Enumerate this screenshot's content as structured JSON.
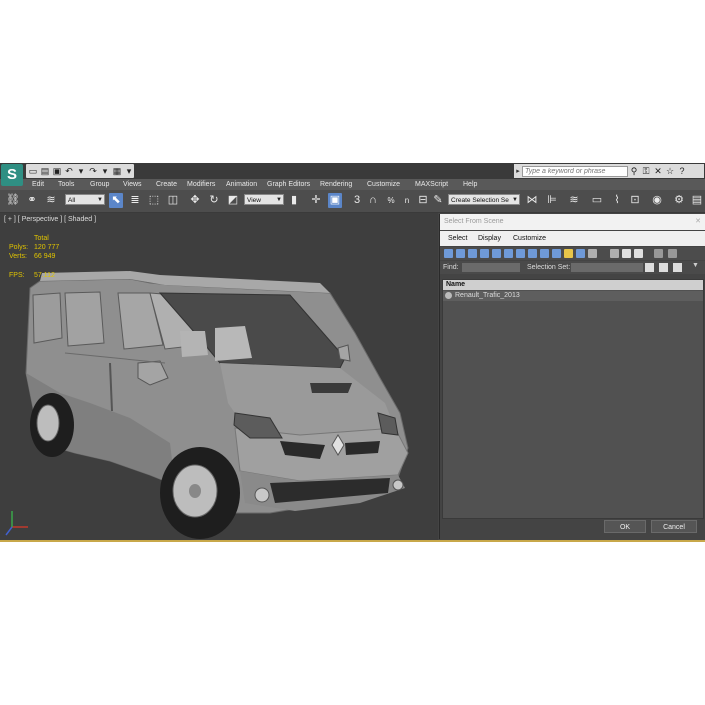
{
  "app": {
    "logo_letter": "S"
  },
  "search": {
    "placeholder": "Type a keyword or phrase"
  },
  "menu": [
    "Edit",
    "Tools",
    "Group",
    "Views",
    "Create",
    "Modifiers",
    "Animation",
    "Graph Editors",
    "Rendering",
    "Customize",
    "MAXScript",
    "Help"
  ],
  "toolbar": {
    "filter_value": "All",
    "view_value": "View",
    "selection_set_value": "Create Selection Se",
    "snap_3": "3",
    "snap_2_5": "2.5",
    "percent": "%",
    "n_label": "n"
  },
  "viewport": {
    "label": "[ + ] [ Perspective ] [ Shaded ]",
    "stats": {
      "total_label": "Total",
      "polys_label": "Polys:",
      "polys_value": "120 777",
      "verts_label": "Verts:",
      "verts_value": "66 949",
      "fps_label": "FPS:",
      "fps_value": "57.112"
    }
  },
  "dialog": {
    "title": "Select From Scene",
    "menu": [
      "Select",
      "Display",
      "Customize"
    ],
    "find_label": "Find:",
    "selection_set_label": "Selection Set:",
    "list_header": "Name",
    "rows": [
      "Renault_Trafic_2013"
    ],
    "ok_label": "OK",
    "cancel_label": "Cancel"
  },
  "colors": {
    "accent_blue": "#5b86c9",
    "stat_yellow": "#e0c400",
    "viewport_bg": "#3e3e3e",
    "logo_teal": "#2f8f83"
  }
}
